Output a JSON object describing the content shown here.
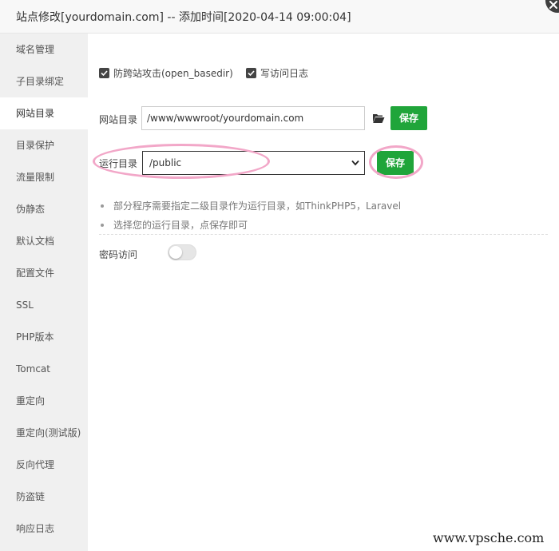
{
  "title": "站点修改[yourdomain.com] -- 添加时间[2020-04-14 09:00:04]",
  "sidebar": {
    "items": [
      {
        "label": "域名管理"
      },
      {
        "label": "子目录绑定"
      },
      {
        "label": "网站目录"
      },
      {
        "label": "目录保护"
      },
      {
        "label": "流量限制"
      },
      {
        "label": "伪静态"
      },
      {
        "label": "默认文档"
      },
      {
        "label": "配置文件"
      },
      {
        "label": "SSL"
      },
      {
        "label": "PHP版本"
      },
      {
        "label": "Tomcat"
      },
      {
        "label": "重定向"
      },
      {
        "label": "重定向(测试版)"
      },
      {
        "label": "反向代理"
      },
      {
        "label": "防盗链"
      },
      {
        "label": "响应日志"
      }
    ],
    "active_index": 2
  },
  "options": {
    "open_basedir_label": "防跨站攻击(open_basedir)",
    "open_basedir_checked": true,
    "access_log_label": "写访问日志",
    "access_log_checked": true
  },
  "site_dir": {
    "label": "网站目录",
    "value": "/www/wwwroot/yourdomain.com",
    "folder_icon": "folder-open-icon",
    "save_label": "保存"
  },
  "run_dir": {
    "label": "运行目录",
    "selected": "/public",
    "save_label": "保存"
  },
  "tips": [
    "部分程序需要指定二级目录作为运行目录，如ThinkPHP5，Laravel",
    "选择您的运行目录，点保存即可"
  ],
  "password_access": {
    "label": "密码访问",
    "enabled": false
  },
  "watermark": "www.vpsche.com",
  "colors": {
    "accent_green": "#20a53a",
    "highlight_pink": "#f2a7c8"
  }
}
